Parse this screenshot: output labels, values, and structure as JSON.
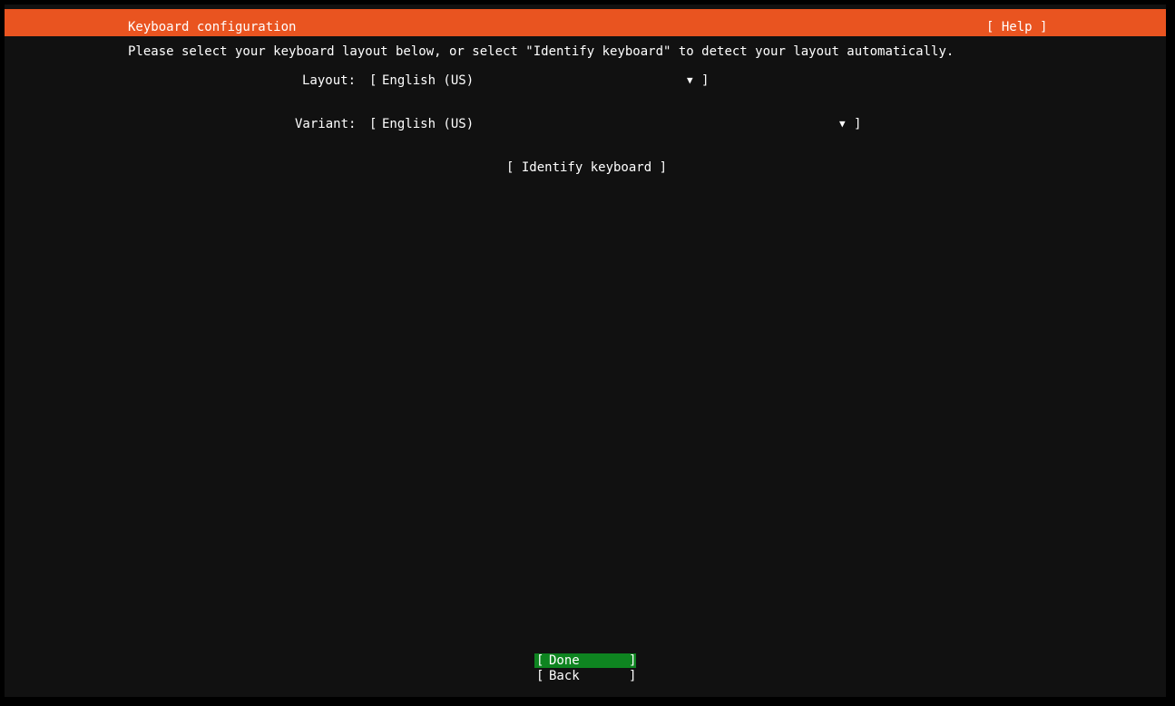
{
  "header": {
    "title": "Keyboard configuration",
    "help_label": "[ Help ]"
  },
  "instruction": "Please select your keyboard layout below, or select \"Identify keyboard\" to detect your layout automatically.",
  "layout": {
    "label": "Layout:",
    "value": "English (US)",
    "arrow": "▼"
  },
  "variant": {
    "label": "Variant:",
    "value": "English (US)",
    "arrow": "▼"
  },
  "identify_label": "[ Identify keyboard ]",
  "buttons": {
    "done": "Done",
    "back": "Back"
  },
  "brackets": {
    "open": "[",
    "close": "]"
  },
  "colors": {
    "header": "#e95420",
    "background": "#111111",
    "selected_button": "#0e8420"
  }
}
